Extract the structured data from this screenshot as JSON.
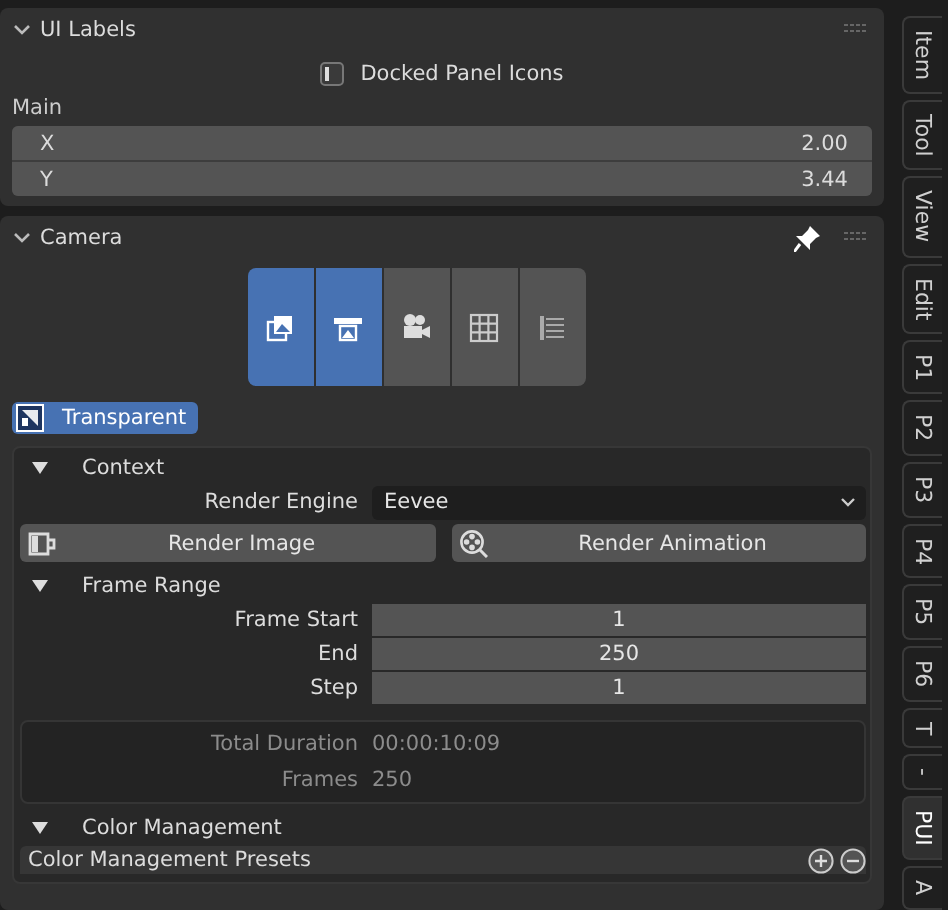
{
  "ui_labels_panel": {
    "title": "UI Labels",
    "expanded": true,
    "docked_toggle": {
      "label": "Docked Panel Icons",
      "checked": false
    },
    "group_label": "Main",
    "vector": [
      {
        "label": "X",
        "value": "2.00"
      },
      {
        "label": "Y",
        "value": "3.44"
      }
    ]
  },
  "camera_panel": {
    "title": "Camera",
    "expanded": true,
    "pinned": true,
    "mode_buttons": [
      {
        "kind": "images",
        "selected": true
      },
      {
        "kind": "printer",
        "selected": true
      },
      {
        "kind": "camera",
        "selected": false
      },
      {
        "kind": "grid",
        "selected": false
      },
      {
        "kind": "list",
        "selected": false
      }
    ],
    "transparent": {
      "label": "Transparent",
      "checked": true
    },
    "context": {
      "title": "Context",
      "expanded": true,
      "render_engine": {
        "label": "Render Engine",
        "value": "Eevee"
      },
      "render_image": "Render Image",
      "render_animation": "Render Animation"
    },
    "frame_range": {
      "title": "Frame Range",
      "expanded": true,
      "fields": [
        {
          "label": "Frame Start",
          "value": "1"
        },
        {
          "label": "End",
          "value": "250"
        },
        {
          "label": "Step",
          "value": "1"
        }
      ],
      "info": [
        {
          "label": "Total Duration",
          "value": "00:00:10:09"
        },
        {
          "label": "Frames",
          "value": "250"
        }
      ]
    },
    "color_management": {
      "title": "Color Management",
      "expanded": true,
      "presets": "Color Management Presets"
    }
  },
  "sidebar_tabs": [
    {
      "label": "Item",
      "selected": false
    },
    {
      "label": "Tool",
      "selected": false
    },
    {
      "label": "View",
      "selected": false
    },
    {
      "label": "Edit",
      "selected": false
    },
    {
      "label": "P1",
      "selected": false
    },
    {
      "label": "P2",
      "selected": false
    },
    {
      "label": "P3",
      "selected": false
    },
    {
      "label": "P4",
      "selected": false
    },
    {
      "label": "P5",
      "selected": false
    },
    {
      "label": "P6",
      "selected": false
    },
    {
      "label": "T",
      "selected": false
    },
    {
      "label": "-",
      "selected": false
    },
    {
      "label": "PUI",
      "selected": true
    },
    {
      "label": "A",
      "selected": false
    }
  ]
}
